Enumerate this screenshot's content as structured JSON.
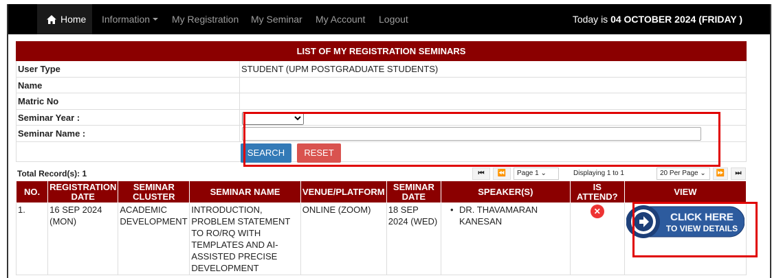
{
  "nav": {
    "home": "Home",
    "information": "Information",
    "my_registration": "My Registration",
    "my_seminar": "My Seminar",
    "my_account": "My Account",
    "logout": "Logout",
    "today_prefix": "Today is ",
    "today_date": "04 OCTOBER 2024 (FRIDAY )"
  },
  "panel": {
    "title": "LIST OF MY REGISTRATION SEMINARS",
    "user_type_label": "User Type",
    "user_type_value": "STUDENT (UPM POSTGRADUATE STUDENTS)",
    "name_label": "Name",
    "name_value": "",
    "matric_label": "Matric No",
    "matric_value": "",
    "year_label": "Seminar Year :",
    "year_value": "",
    "seminar_name_label": "Seminar Name :",
    "seminar_name_value": "",
    "search_label": "SEARCH",
    "reset_label": "RESET"
  },
  "pager": {
    "total": "Total Record(s): 1",
    "first": "⏮",
    "prev": "⏪",
    "page": "Page 1",
    "displaying": "Displaying 1 to 1",
    "per_page": "20 Per Page",
    "next": "⏩",
    "last": "⏭"
  },
  "table": {
    "headers": [
      "NO.",
      "REGISTRATION DATE",
      "SEMINAR CLUSTER",
      "SEMINAR NAME",
      "VENUE/PLATFORM",
      "SEMINAR DATE",
      "SPEAKER(S)",
      "IS ATTEND?",
      "VIEW"
    ],
    "rows": [
      {
        "no": "1.",
        "reg_date": "16 SEP 2024 (MON)",
        "cluster": "ACADEMIC DEVELOPMENT",
        "name": "INTRODUCTION, PROBLEM STATEMENT TO RO/RQ WITH TEMPLATES AND AI-ASSISTED PRECISE DEVELOPMENT",
        "venue": "ONLINE (ZOOM)",
        "sem_date": "18 SEP 2024 (WED)",
        "speaker": "DR. THAVAMARAN KANESAN",
        "attend_icon": "close-icon",
        "view_line1": "CLICK HERE",
        "view_line2": "TO VIEW DETAILS"
      }
    ]
  },
  "colors": {
    "header_red": "#8b0000",
    "search_blue": "#337ab7",
    "reset_red": "#d9534f",
    "highlight": "#e00000",
    "view_blue": "#2d5b9e"
  }
}
